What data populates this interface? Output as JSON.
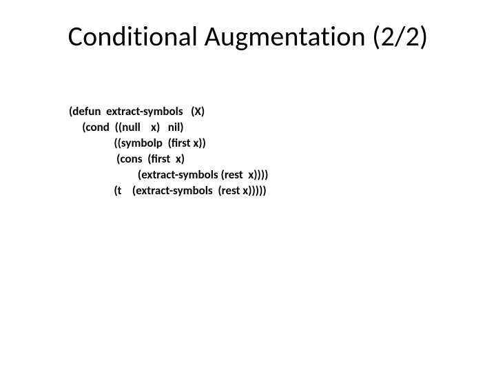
{
  "slide": {
    "title": "Conditional Augmentation (2/2)",
    "code": {
      "line1": "(defun  extract-symbols   (X)",
      "line2": "     (cond  ((null    x)   nil)",
      "line3": "                 ((symbolp  (first x))",
      "line4": "                  (cons  (first  x)",
      "line5": "                          (extract-symbols (rest  x))))",
      "line6": "                 (t    (extract-symbols  (rest x)))))"
    }
  }
}
